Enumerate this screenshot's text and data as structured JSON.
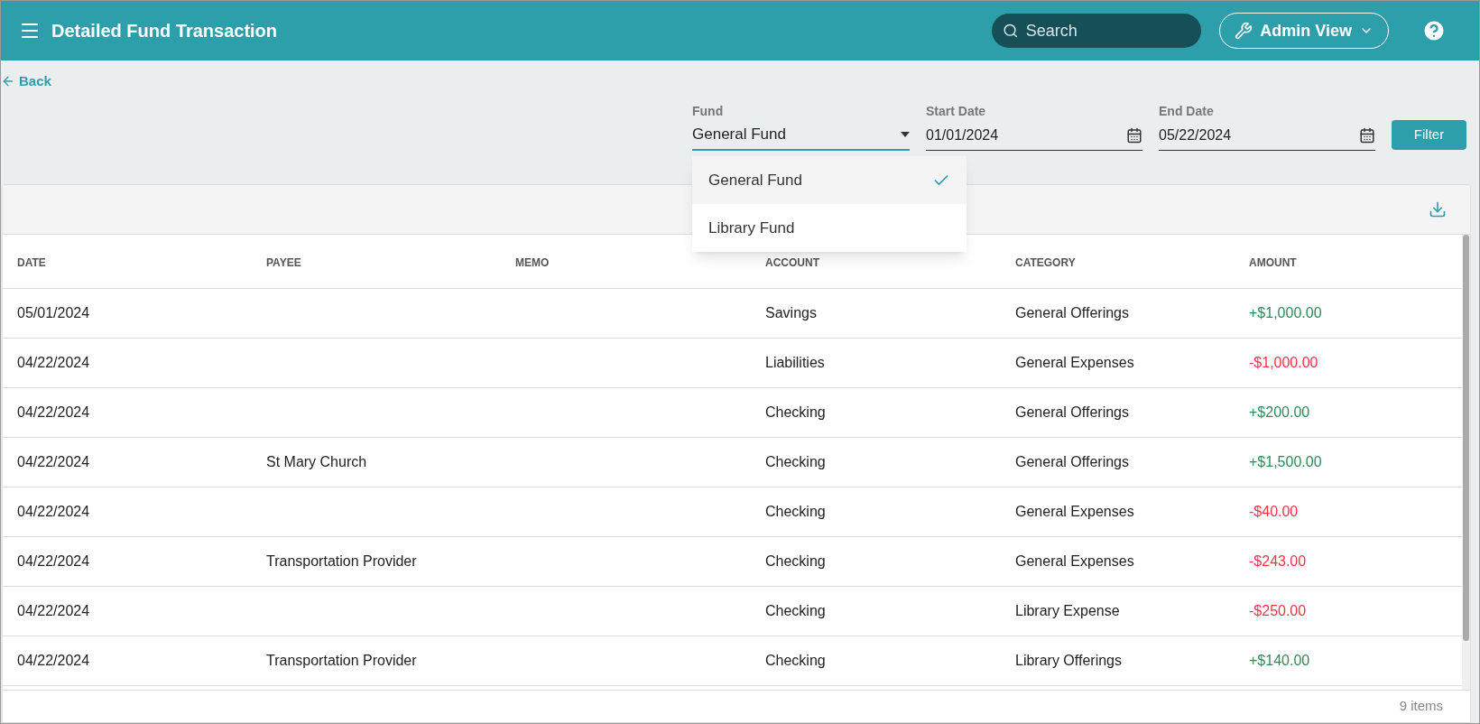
{
  "header": {
    "title": "Detailed Fund Transaction",
    "search": {
      "placeholder": "Search"
    },
    "view_button": "Admin View"
  },
  "back_link": "Back",
  "filters": {
    "fund": {
      "label": "Fund",
      "value": "General Fund",
      "expanded": true,
      "options": [
        {
          "label": "General Fund",
          "selected": true
        },
        {
          "label": "Library Fund",
          "selected": false
        }
      ]
    },
    "start_date": {
      "label": "Start Date",
      "value": "01/01/2024"
    },
    "end_date": {
      "label": "End Date",
      "value": "05/22/2024"
    },
    "button": "Filter"
  },
  "table": {
    "columns": [
      "DATE",
      "PAYEE",
      "MEMO",
      "ACCOUNT",
      "CATEGORY",
      "AMOUNT"
    ],
    "rows": [
      {
        "date": "05/01/2024",
        "payee": "",
        "memo": "",
        "account": "Savings",
        "category": "General Offerings",
        "amount": "+$1,000.00",
        "kind": "credit"
      },
      {
        "date": "04/22/2024",
        "payee": "",
        "memo": "",
        "account": "Liabilities",
        "category": "General Expenses",
        "amount": "-$1,000.00",
        "kind": "debit"
      },
      {
        "date": "04/22/2024",
        "payee": "",
        "memo": "",
        "account": "Checking",
        "category": "General Offerings",
        "amount": "+$200.00",
        "kind": "credit"
      },
      {
        "date": "04/22/2024",
        "payee": "St Mary Church",
        "memo": "",
        "account": "Checking",
        "category": "General Offerings",
        "amount": "+$1,500.00",
        "kind": "credit"
      },
      {
        "date": "04/22/2024",
        "payee": "",
        "memo": "",
        "account": "Checking",
        "category": "General Expenses",
        "amount": "-$40.00",
        "kind": "debit"
      },
      {
        "date": "04/22/2024",
        "payee": "Transportation Provider",
        "memo": "",
        "account": "Checking",
        "category": "General Expenses",
        "amount": "-$243.00",
        "kind": "debit"
      },
      {
        "date": "04/22/2024",
        "payee": "",
        "memo": "",
        "account": "Checking",
        "category": "Library Expense",
        "amount": "-$250.00",
        "kind": "debit"
      },
      {
        "date": "04/22/2024",
        "payee": "Transportation Provider",
        "memo": "",
        "account": "Checking",
        "category": "Library Offerings",
        "amount": "+$140.00",
        "kind": "credit"
      }
    ],
    "footer": "9 items"
  }
}
